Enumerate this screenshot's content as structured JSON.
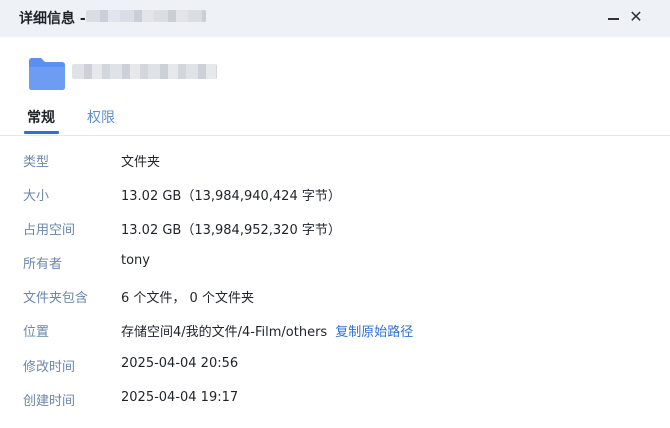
{
  "window": {
    "title": "详细信息 -",
    "minimize_icon": "minimize-icon",
    "close_icon": "close-icon",
    "close_glyph": "✕"
  },
  "header": {
    "icon": "folder-icon",
    "folder_color": "#5b8ff0"
  },
  "tabs": [
    {
      "label": "常规",
      "active": true
    },
    {
      "label": "权限",
      "active": false
    }
  ],
  "details": {
    "type_label": "类型",
    "type_value": "文件夹",
    "size_label": "大小",
    "size_value": "13.02 GB（13,984,940,424 字节）",
    "used_label": "占用空间",
    "used_value": "13.02 GB（13,984,952,320 字节）",
    "owner_label": "所有者",
    "owner_value": "tony",
    "contains_label": "文件夹包含",
    "contains_value": "6 个文件， 0 个文件夹",
    "location_label": "位置",
    "location_value": "存储空间4/我的文件/4-Film/others",
    "copy_path_link": "复制原始路径",
    "modified_label": "修改时间",
    "modified_value": "2025-04-04 20:56",
    "created_label": "创建时间",
    "created_value": "2025-04-04 19:17"
  },
  "colors": {
    "accent": "#2f6fdb",
    "label": "#6b86ad",
    "titlebar_bg": "#eef2f7"
  }
}
